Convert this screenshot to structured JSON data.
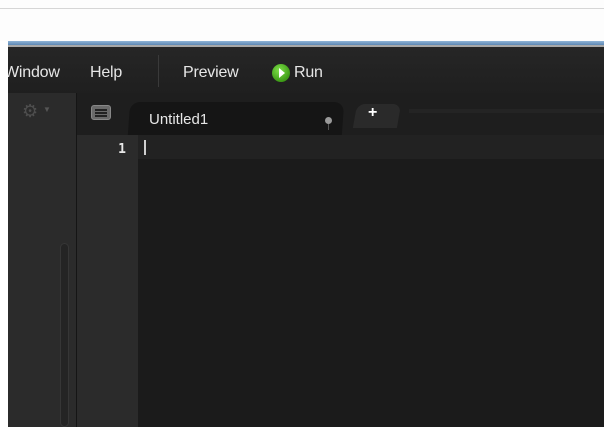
{
  "menu": {
    "window_label": "Window",
    "help_label": "Help",
    "preview_label": "Preview",
    "run_label": "Run",
    "run_icon": "play-circle-green"
  },
  "sidebar": {
    "settings_icon": "gear-icon"
  },
  "tabs": {
    "active_tab_label": "Untitled1",
    "add_tab_label": "+"
  },
  "editor": {
    "line_numbers": [
      "1"
    ],
    "content": ""
  },
  "colors": {
    "accent": "#5e88b4",
    "run_green": "#3d9b16"
  }
}
